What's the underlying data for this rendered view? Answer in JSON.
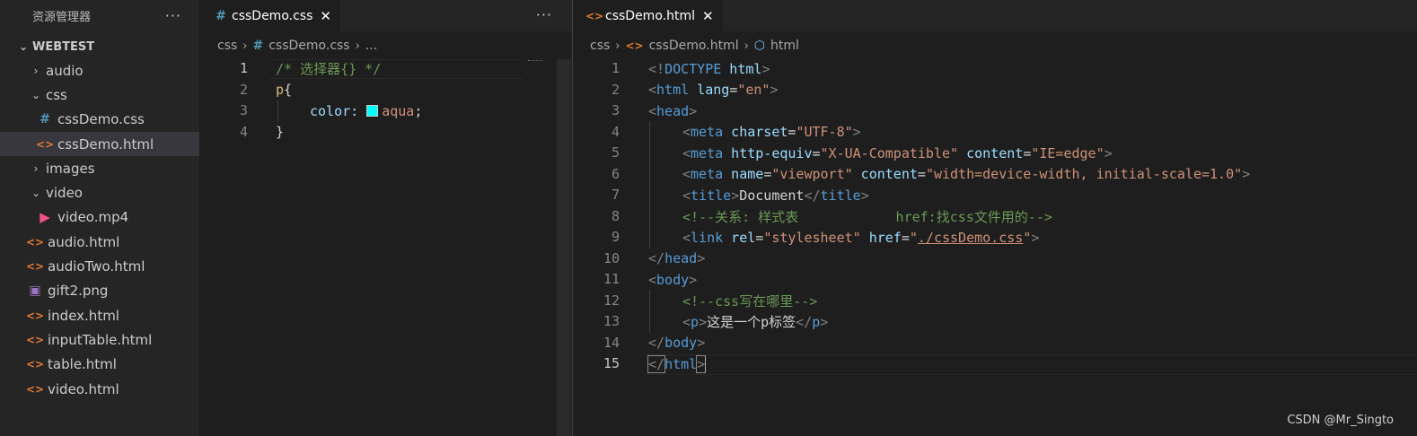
{
  "explorer": {
    "title": "资源管理器",
    "more": "···",
    "root": "WEBTEST",
    "items": [
      {
        "label": "audio",
        "type": "folder",
        "expanded": false,
        "depth": 1,
        "icon": "chevron-right-icon"
      },
      {
        "label": "css",
        "type": "folder",
        "expanded": true,
        "depth": 1,
        "icon": "chevron-down-icon"
      },
      {
        "label": "cssDemo.css",
        "type": "css",
        "depth": 2,
        "icon": "css-file-icon"
      },
      {
        "label": "cssDemo.html",
        "type": "html",
        "depth": 2,
        "icon": "html-file-icon",
        "selected": true
      },
      {
        "label": "images",
        "type": "folder",
        "expanded": false,
        "depth": 1,
        "icon": "chevron-right-icon"
      },
      {
        "label": "video",
        "type": "folder",
        "expanded": true,
        "depth": 1,
        "icon": "chevron-down-icon"
      },
      {
        "label": "video.mp4",
        "type": "video",
        "depth": 2,
        "icon": "video-file-icon"
      },
      {
        "label": "audio.html",
        "type": "html",
        "depth": 1,
        "icon": "html-file-icon"
      },
      {
        "label": "audioTwo.html",
        "type": "html",
        "depth": 1,
        "icon": "html-file-icon"
      },
      {
        "label": "gift2.png",
        "type": "image",
        "depth": 1,
        "icon": "image-file-icon"
      },
      {
        "label": "index.html",
        "type": "html",
        "depth": 1,
        "icon": "html-file-icon"
      },
      {
        "label": "inputTable.html",
        "type": "html",
        "depth": 1,
        "icon": "html-file-icon"
      },
      {
        "label": "table.html",
        "type": "html",
        "depth": 1,
        "icon": "html-file-icon"
      },
      {
        "label": "video.html",
        "type": "html",
        "depth": 1,
        "icon": "html-file-icon"
      }
    ]
  },
  "left_editor": {
    "tab_label": "cssDemo.css",
    "tab_close": "✕",
    "more": "···",
    "breadcrumb": {
      "folder": "css",
      "file": "cssDemo.css",
      "rest": "..."
    },
    "line_numbers": [
      "1",
      "2",
      "3",
      "4"
    ],
    "current_line": "1",
    "code": {
      "l1": "/* 选择器{} */",
      "l2_sel": "p",
      "l2_brace": "{",
      "l3_prop": "color:",
      "l3_val": "aqua",
      "l3_semi": ";",
      "l4": "}"
    },
    "swatch_color": "#00ffff"
  },
  "right_editor": {
    "tab_label": "cssDemo.html",
    "tab_close": "✕",
    "breadcrumb": {
      "folder": "css",
      "file": "cssDemo.html",
      "symbol": "html"
    },
    "line_numbers": [
      "1",
      "2",
      "3",
      "4",
      "5",
      "6",
      "7",
      "8",
      "9",
      "10",
      "11",
      "12",
      "13",
      "14",
      "15"
    ],
    "current_line": "15",
    "code": {
      "l1a": "<!",
      "l1b": "DOCTYPE",
      "l1c": " html",
      "l1d": ">",
      "l2a": "<",
      "l2b": "html",
      "l2c": " lang",
      "l2d": "=",
      "l2e": "\"en\"",
      "l2f": ">",
      "l3a": "<",
      "l3b": "head",
      "l3c": ">",
      "l4a": "<",
      "l4b": "meta",
      "l4c": " charset",
      "l4d": "=",
      "l4e": "\"UTF-8\"",
      "l4f": ">",
      "l5a": "<",
      "l5b": "meta",
      "l5c": " http-equiv",
      "l5d": "=",
      "l5e": "\"X-UA-Compatible\"",
      "l5f": " content",
      "l5g": "=",
      "l5h": "\"IE=edge\"",
      "l5i": ">",
      "l6a": "<",
      "l6b": "meta",
      "l6c": " name",
      "l6d": "=",
      "l6e": "\"viewport\"",
      "l6f": " content",
      "l6g": "=",
      "l6h": "\"width=device-width, initial-scale=1.0\"",
      "l6i": ">",
      "l7a": "<",
      "l7b": "title",
      "l7c": ">",
      "l7d": "Document",
      "l7e": "</",
      "l7f": "title",
      "l7g": ">",
      "l8": "<!--关系: 样式表            href:找css文件用的-->",
      "l9a": "<",
      "l9b": "link",
      "l9c": " rel",
      "l9d": "=",
      "l9e": "\"stylesheet\"",
      "l9f": " href",
      "l9g": "=",
      "l9h": "\"",
      "l9i": "./cssDemo.css",
      "l9j": "\"",
      "l9k": ">",
      "l10a": "</",
      "l10b": "head",
      "l10c": ">",
      "l11a": "<",
      "l11b": "body",
      "l11c": ">",
      "l12": "<!--css写在哪里-->",
      "l13a": "<",
      "l13b": "p",
      "l13c": ">",
      "l13d": "这是一个p标签",
      "l13e": "</",
      "l13f": "p",
      "l13g": ">",
      "l14a": "</",
      "l14b": "body",
      "l14c": ">",
      "l15a": "</",
      "l15b": "html",
      "l15c": ">"
    }
  },
  "watermark": "CSDN @Mr_Singto",
  "colors": {
    "accent": "#007acc",
    "sidebar": "#252526",
    "editor": "#1e1e1e"
  }
}
